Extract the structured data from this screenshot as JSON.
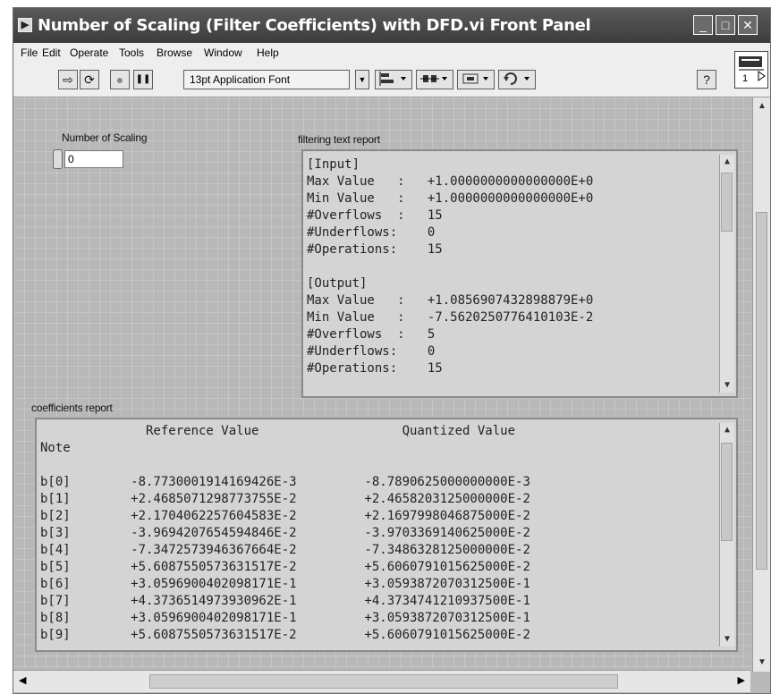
{
  "window": {
    "title": "Number of Scaling (Filter Coefficients) with DFD.vi Front Panel",
    "app_icon": "labview-run-icon",
    "minimize": "_",
    "maximize": "□",
    "close": "✕"
  },
  "menu": [
    "File",
    "Edit",
    "Operate",
    "Tools",
    "Browse",
    "Window",
    "Help"
  ],
  "toolbar": {
    "run_icon": "⇨",
    "run_continuous_icon": "⟳",
    "abort_icon": "●",
    "pause_icon": "❚❚",
    "font": "13pt Application Font",
    "align_icon": "align-objects-icon",
    "distribute_icon": "distribute-objects-icon",
    "resize_icon": "resize-objects-icon",
    "reorder_icon": "reorder-icon",
    "help": "?",
    "vi_icon_number": "1"
  },
  "controls": {
    "number_of_scaling": {
      "label": "Number of Scaling",
      "value": "0"
    }
  },
  "filtering": {
    "label": "filtering text report",
    "lines": [
      "[Input]",
      "Max Value   :   +1.0000000000000000E+0",
      "Min Value   :   +1.0000000000000000E+0",
      "#Overflows  :   15",
      "#Underflows:    0",
      "#Operations:    15",
      "",
      "[Output]",
      "Max Value   :   +1.0856907432898879E+0",
      "Min Value   :   -7.5620250776410103E-2",
      "#Overflows  :   5",
      "#Underflows:    0",
      "#Operations:    15"
    ]
  },
  "coefficients": {
    "label": "coefficients report",
    "lines": [
      "              Reference Value                   Quantized Value",
      "Note",
      "",
      "b[0]        -8.7730001914169426E-3         -8.7890625000000000E-3",
      "b[1]        +2.4685071298773755E-2         +2.4658203125000000E-2",
      "b[2]        +2.1704062257604583E-2         +2.1697998046875000E-2",
      "b[3]        -3.9694207654594846E-2         -3.9703369140625000E-2",
      "b[4]        -7.3472573946367664E-2         -7.3486328125000000E-2",
      "b[5]        +5.6087550573631517E-2         +5.6060791015625000E-2",
      "b[6]        +3.0596900402098171E-1         +3.0593872070312500E-1",
      "b[7]        +4.3736514973930962E-1         +4.3734741210937500E-1",
      "b[8]        +3.0596900402098171E-1         +3.0593872070312500E-1",
      "b[9]        +5.6087550573631517E-2         +5.6060791015625000E-2"
    ]
  }
}
